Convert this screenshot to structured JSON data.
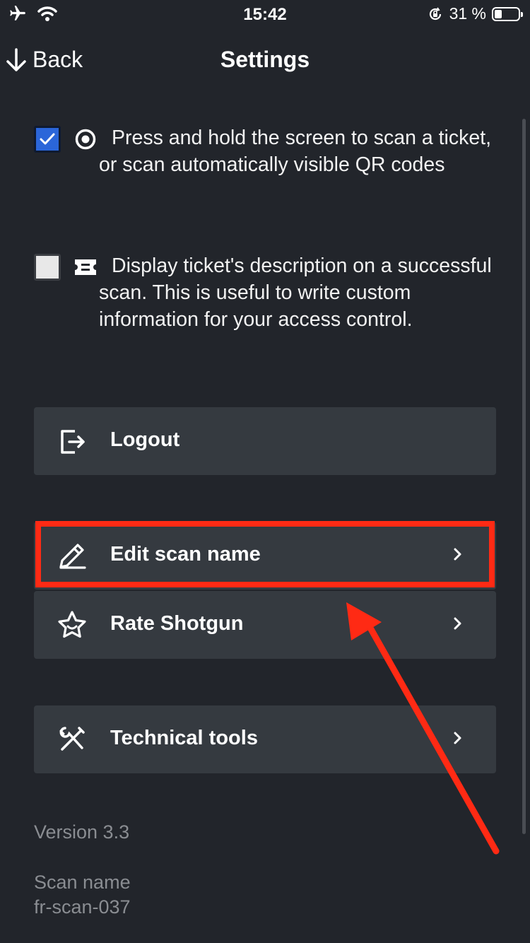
{
  "status_bar": {
    "time": "15:42",
    "battery_percent": "31 %",
    "battery_level": 0.31,
    "icons": [
      "airplane-icon",
      "wifi-icon",
      "orientation-lock-icon",
      "battery-icon"
    ]
  },
  "nav": {
    "back_label": "Back",
    "title": "Settings"
  },
  "options": [
    {
      "checked": true,
      "icon": "target-icon",
      "text": "Press and hold the screen to scan a ticket, or scan automatically visible QR codes"
    },
    {
      "checked": false,
      "icon": "ticket-icon",
      "text": "Display ticket's description on a successful scan. This is useful to write custom information for your access control."
    }
  ],
  "menu": {
    "logout": {
      "label": "Logout",
      "icon": "logout-icon"
    },
    "edit_scan_name": {
      "label": "Edit scan name",
      "icon": "pencil-icon"
    },
    "rate_shotgun": {
      "label": "Rate Shotgun",
      "icon": "star-icon"
    },
    "technical_tools": {
      "label": "Technical tools",
      "icon": "tools-icon"
    }
  },
  "footer": {
    "version": "Version 3.3",
    "scan_name_label": "Scan name",
    "scan_name_value": "fr-scan-037"
  },
  "colors": {
    "background": "#22252b",
    "card": "#353a40",
    "checkbox_checked": "#2b66d9",
    "annotation": "#ff2a14",
    "muted_text": "#8a8d92"
  }
}
